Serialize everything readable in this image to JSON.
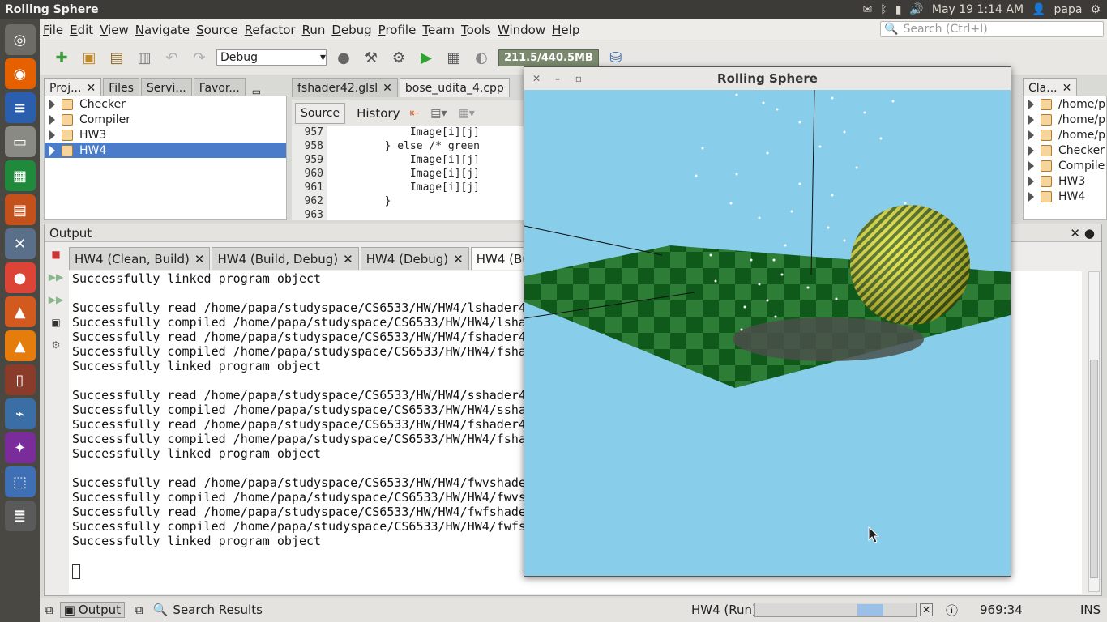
{
  "topbar": {
    "title": "Rolling Sphere",
    "datetime": "May 19  1:14 AM",
    "user": "papa"
  },
  "menu": [
    "File",
    "Edit",
    "View",
    "Navigate",
    "Source",
    "Refactor",
    "Run",
    "Debug",
    "Profile",
    "Team",
    "Tools",
    "Window",
    "Help"
  ],
  "search": {
    "placeholder": "Search (Ctrl+I)"
  },
  "toolbar": {
    "config": "Debug",
    "memory": "211.5/440.5MB"
  },
  "projects": {
    "tabs": [
      "Proj...",
      "Files",
      "Servi...",
      "Favor..."
    ],
    "items": [
      "Checker",
      "Compiler",
      "HW3",
      "HW4"
    ]
  },
  "editor": {
    "tabs": [
      "fshader42.glsl",
      "bose_udita_4.cpp"
    ],
    "subtabs": [
      "Source",
      "History"
    ],
    "lines": [
      {
        "n": "957",
        "code": "            Image[i][j]"
      },
      {
        "n": "958",
        "code": "        } else /* green"
      },
      {
        "n": "959",
        "code": "            Image[i][j]"
      },
      {
        "n": "960",
        "code": "            Image[i][j]"
      },
      {
        "n": "961",
        "code": "            Image[i][j]"
      },
      {
        "n": "962",
        "code": "        }"
      },
      {
        "n": "963",
        "code": ""
      }
    ]
  },
  "classes": {
    "tab": "Cla...",
    "items": [
      "/home/p",
      "/home/p",
      "/home/p",
      "Checker",
      "Compile",
      "HW3",
      "HW4"
    ]
  },
  "output": {
    "title": "Output",
    "tabs": [
      "HW4 (Clean, Build)",
      "HW4 (Build, Debug)",
      "HW4 (Debug)",
      "HW4 (Build, Run)"
    ],
    "lines": [
      "Successfully linked program object",
      "",
      "Successfully read /home/papa/studyspace/CS6533/HW/HW4/lshader4",
      "Successfully compiled /home/papa/studyspace/CS6533/HW/HW4/lsha",
      "Successfully read /home/papa/studyspace/CS6533/HW/HW4/fshader4",
      "Successfully compiled /home/papa/studyspace/CS6533/HW/HW4/fsha",
      "Successfully linked program object",
      "",
      "Successfully read /home/papa/studyspace/CS6533/HW/HW4/sshader4",
      "Successfully compiled /home/papa/studyspace/CS6533/HW/HW4/ssha",
      "Successfully read /home/papa/studyspace/CS6533/HW/HW4/fshader4",
      "Successfully compiled /home/papa/studyspace/CS6533/HW/HW4/fsha",
      "Successfully linked program object",
      "",
      "Successfully read /home/papa/studyspace/CS6533/HW/HW4/fwvshade",
      "Successfully compiled /home/papa/studyspace/CS6533/HW/HW4/fwvs",
      "Successfully read /home/papa/studyspace/CS6533/HW/HW4/fwfshade",
      "Successfully compiled /home/papa/studyspace/CS6533/HW/HW4/fwfs",
      "Successfully linked program object"
    ]
  },
  "window": {
    "title": "Rolling Sphere"
  },
  "status": {
    "output_tab": "Output",
    "search_tab": "Search Results",
    "task": "HW4 (Run)",
    "position": "969:34",
    "mode": "INS"
  },
  "colors": {
    "sky": "#88cdea",
    "sphere": "#d4d42a",
    "floor_dark": "#0f5a1a",
    "floor_light": "#2e7d36",
    "selection": "#4a7cc9"
  }
}
